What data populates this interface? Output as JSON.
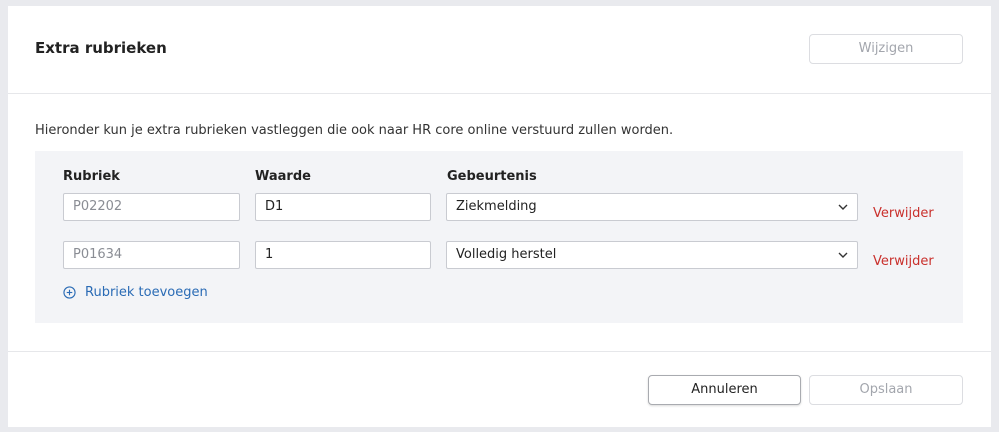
{
  "header": {
    "title": "Extra rubrieken",
    "edit_label": "Wijzigen"
  },
  "intro_text": "Hieronder kun je extra rubrieken vastleggen die ook naar HR core online verstuurd zullen worden.",
  "columns": {
    "rubriek": "Rubriek",
    "waarde": "Waarde",
    "gebeurtenis": "Gebeurtenis"
  },
  "rows": [
    {
      "rubriek_placeholder": "P02202",
      "waarde": "D1",
      "gebeurtenis": "Ziekmelding",
      "remove_label": "Verwijder"
    },
    {
      "rubriek_placeholder": "P01634",
      "waarde": "1",
      "gebeurtenis": "Volledig herstel",
      "remove_label": "Verwijder"
    }
  ],
  "add_label": "Rubriek toevoegen",
  "footer": {
    "cancel_label": "Annuleren",
    "save_label": "Opslaan"
  },
  "colors": {
    "remove": "#c9302c",
    "link": "#2a6bb5",
    "panel_bg": "#f3f4f7"
  }
}
